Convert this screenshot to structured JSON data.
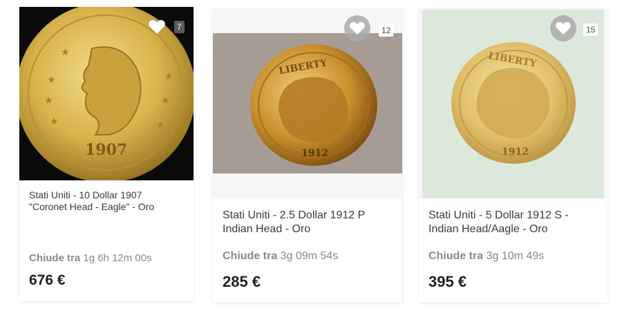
{
  "listings": [
    {
      "image": "coin-photo-coronet-head-1907",
      "favorite_icon": "heart-icon",
      "favorite_count": "7",
      "title_line1": "Stati Uniti - 10 Dollar 1907",
      "title_line2": "\"Coronet Head - Eagle\" - Oro",
      "closing_label": "Chiude tra",
      "closing_time": "1g 6h 12m 00s",
      "price": "676 €",
      "coin_date": "1907"
    },
    {
      "image": "coin-photo-indian-head-1912",
      "favorite_icon": "heart-icon",
      "favorite_count": "12",
      "title_line1": "Stati Uniti - 2.5 Dollar 1912 P",
      "title_line2": "Indian Head - Oro",
      "closing_label": "Chiude tra",
      "closing_time": "3g 09m 54s",
      "price": "285 €",
      "coin_date": "1912",
      "coin_legend": "LIBERTY"
    },
    {
      "image": "coin-photo-indian-head-1912-s",
      "favorite_icon": "heart-icon",
      "favorite_count": "15",
      "title_line1": "Stati Uniti - 5 Dollar 1912 S -",
      "title_line2": "Indian Head/Aagle - Oro",
      "closing_label": "Chiude tra",
      "closing_time": "3g 10m 49s",
      "price": "395 €",
      "coin_date": "1912",
      "coin_legend": "LIBERTY"
    }
  ],
  "colors": {
    "accent_gold": "#d8b24a",
    "text_dark": "#222222",
    "text_muted": "#888888"
  }
}
